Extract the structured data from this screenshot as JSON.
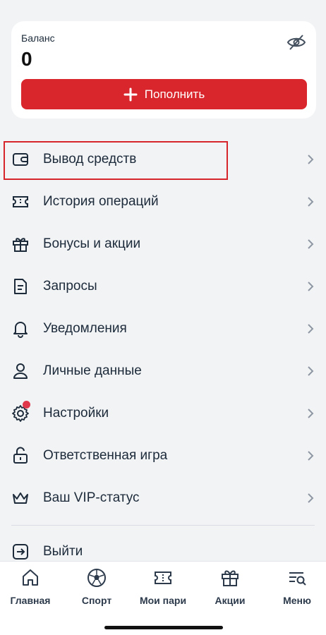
{
  "balance": {
    "label": "Баланс",
    "value": "0",
    "topup_label": "Пополнить",
    "eye_icon": "eye-slash-icon"
  },
  "menu": {
    "items": [
      {
        "label": "Вывод средств",
        "icon": "wallet-icon",
        "highlighted": true
      },
      {
        "label": "История операций",
        "icon": "ticket-icon"
      },
      {
        "label": "Бонусы и акции",
        "icon": "gift-icon"
      },
      {
        "label": "Запросы",
        "icon": "document-icon"
      },
      {
        "label": "Уведомления",
        "icon": "bell-icon"
      },
      {
        "label": "Личные данные",
        "icon": "user-icon"
      },
      {
        "label": "Настройки",
        "icon": "gear-icon",
        "badge_dot": true
      },
      {
        "label": "Ответственная игра",
        "icon": "unlock-icon"
      },
      {
        "label": "Ваш VIP-статус",
        "icon": "crown-icon"
      }
    ],
    "logout_label": "Выйти"
  },
  "bottom_nav": {
    "items": [
      {
        "label": "Главная",
        "icon": "home-icon"
      },
      {
        "label": "Спорт",
        "icon": "soccer-ball-icon"
      },
      {
        "label": "Мои пари",
        "icon": "ticket-icon"
      },
      {
        "label": "Акции",
        "icon": "gift-icon"
      },
      {
        "label": "Меню",
        "icon": "menu-search-icon"
      }
    ]
  },
  "colors": {
    "accent": "#d9262c",
    "background": "#f2f3f5",
    "text": "#1c2a3a",
    "highlight_border": "#d6262c"
  }
}
